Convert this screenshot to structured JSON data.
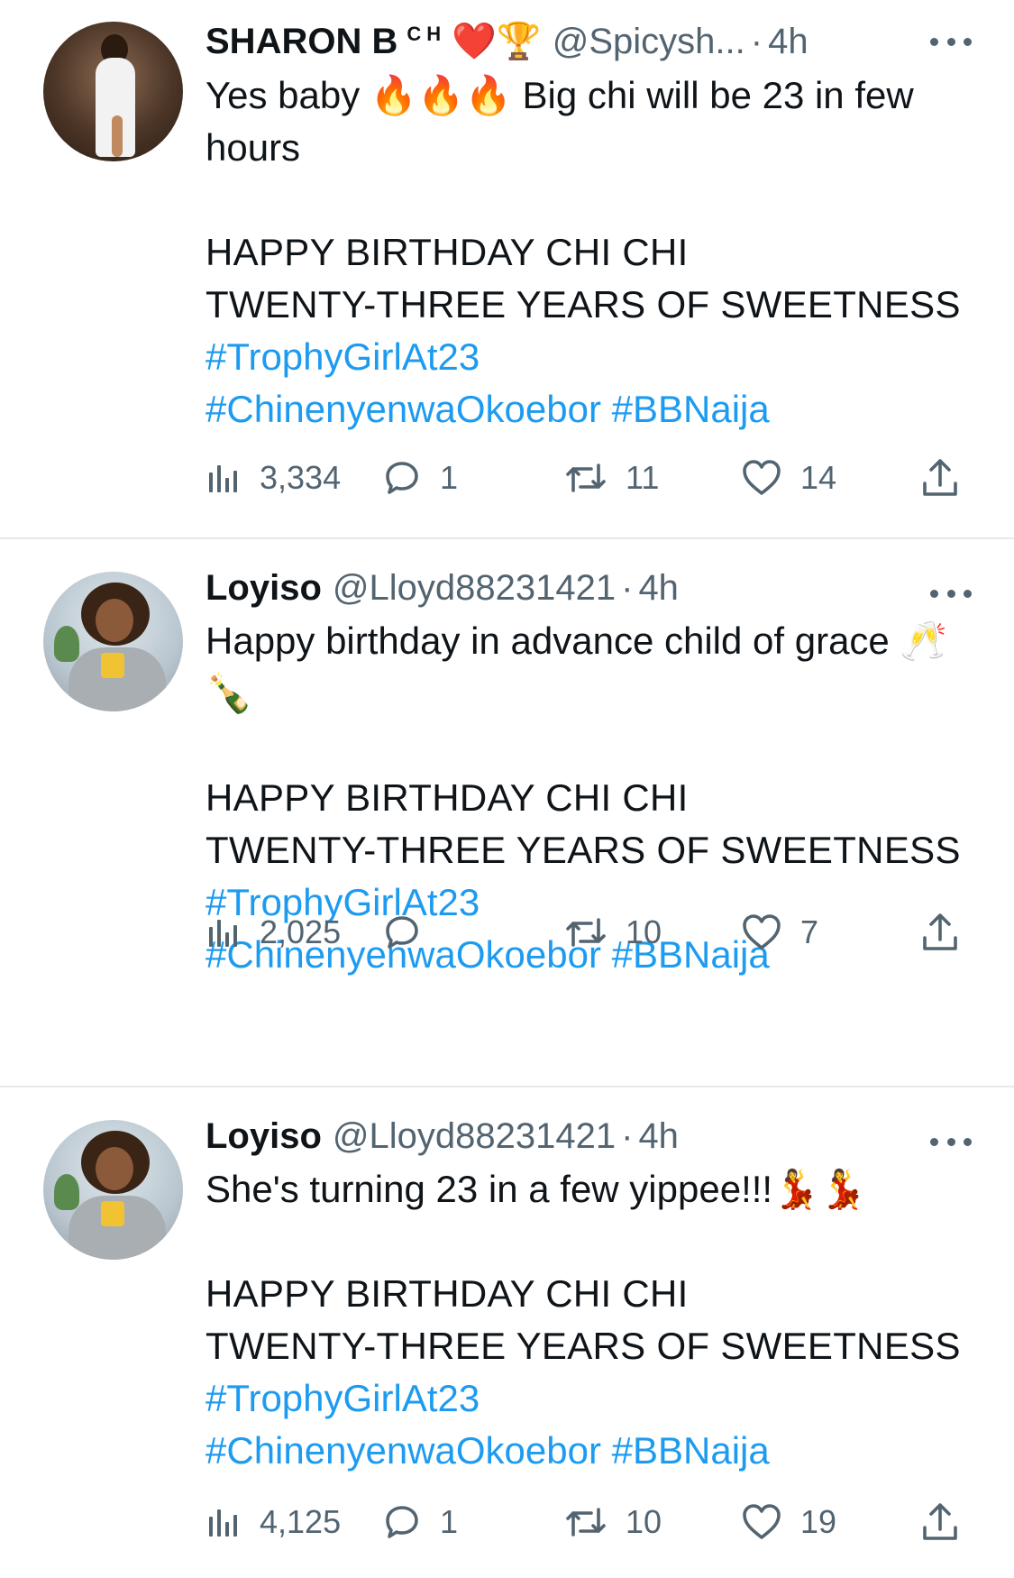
{
  "tweets": [
    {
      "name": "SHARON B",
      "name_extra": "CH",
      "badges": "❤️🏆",
      "handle": "@Spicysh...",
      "dot": "·",
      "time": "4h",
      "text_line1": "Yes baby 🔥🔥🔥 Big chi will be 23 in few hours",
      "caps1": "HAPPY BIRTHDAY CHI CHI",
      "caps2": "TWENTY-THREE YEARS OF SWEETNESS",
      "hashtag1": "#TrophyGirlAt23",
      "hashtag2": "#ChinenyenwaOkoebor",
      "hashtag3": "#BBNaija",
      "views": "3,334",
      "replies": "1",
      "retweets": "11",
      "likes": "14"
    },
    {
      "name": "Loyiso",
      "handle": "@Lloyd88231421",
      "dot": "·",
      "time": "4h",
      "text_line1": "Happy birthday in advance child of grace 🥂🍾",
      "caps1": "HAPPY BIRTHDAY CHI CHI",
      "caps2": "TWENTY-THREE YEARS OF SWEETNESS",
      "hashtag1": "#TrophyGirlAt23",
      "hashtag2": "#ChinenyenwaOkoebor",
      "hashtag3": "#BBNaija",
      "views": "2,025",
      "replies": "",
      "retweets": "10",
      "likes": "7"
    },
    {
      "name": "Loyiso",
      "handle": "@Lloyd88231421",
      "dot": "·",
      "time": "4h",
      "text_line1": "She's turning 23 in a few yippee!!!💃💃",
      "caps1": "HAPPY BIRTHDAY CHI CHI",
      "caps2": "TWENTY-THREE YEARS OF SWEETNESS",
      "hashtag1": "#TrophyGirlAt23",
      "hashtag2": "#ChinenyenwaOkoebor",
      "hashtag3": "#BBNaija",
      "views": "4,125",
      "replies": "1",
      "retweets": "10",
      "likes": "19"
    }
  ],
  "icons": {
    "views": "bar-chart-icon",
    "reply": "speech-bubble-icon",
    "retweet": "retweet-icon",
    "like": "heart-icon",
    "share": "share-upload-icon",
    "more": "more-dots-icon"
  },
  "colors": {
    "text": "#0f1419",
    "secondary": "#536471",
    "hashtag": "#1d9bf0",
    "divider": "#e6e9ec"
  }
}
